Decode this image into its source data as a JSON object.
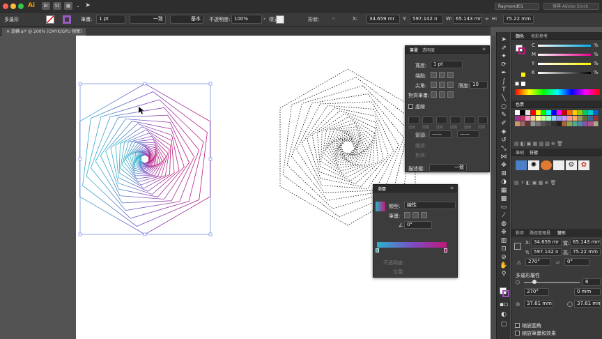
{
  "app": {
    "logo": "Ai",
    "workspace": "Raymond01",
    "stock_placeholder": "搜尋 Adobe Stock"
  },
  "menu": {
    "buttons": [
      "Br",
      "St"
    ]
  },
  "control": {
    "selection": "多邊形",
    "stroke_label": "筆畫:",
    "stroke_weight": "1 pt",
    "profile": "一致",
    "brush": "基本",
    "opacity_label": "不透明度:",
    "opacity": "100%",
    "style_label": "樣式:",
    "shape_label": "形狀:",
    "x_label": "X:",
    "x": "34.659 mr",
    "y_label": "Y:",
    "y": "597.142 n",
    "w_label": "W:",
    "w": "65.143 mr",
    "h_label": "H:",
    "h": "75.22 mm"
  },
  "document": {
    "tab": "旋轉.ai* @ 200% (CMYK/GPU 預覽)"
  },
  "stroke_panel": {
    "tabs": [
      "筆畫",
      "透明度"
    ],
    "weight_label": "寬度:",
    "weight": "1 pt",
    "cap_label": "端點:",
    "corner_label": "尖角:",
    "limit_label": "限度:",
    "limit": "10",
    "align_label": "對齊筆畫:",
    "dashed_label": "虛線",
    "dash_cells": [
      "虛線",
      "間隔",
      "虛線",
      "間隔",
      "虛線",
      "間隔"
    ],
    "arrow_label": "箭頭:",
    "scale_label": "縮放:",
    "align2_label": "對齊:",
    "profile_label": "描述檔:",
    "profile": "一致"
  },
  "gradient_panel": {
    "title": "漸層",
    "type_label": "類型:",
    "type": "線性",
    "stroke_label": "筆畫:",
    "angle": "0°",
    "opacity_label": "不透明度:",
    "location_label": "位置:"
  },
  "color_panel": {
    "tabs": [
      "顏色",
      "色彩參考"
    ],
    "channels": [
      {
        "name": "C",
        "unit": "%"
      },
      {
        "name": "M",
        "unit": "%"
      },
      {
        "name": "Y",
        "unit": "%"
      },
      {
        "name": "K",
        "unit": "%"
      }
    ]
  },
  "swatches_panel": {
    "title": "色票"
  },
  "brushes_panel": {
    "tabs": [
      "筆刷",
      "符號"
    ]
  },
  "transform_panel": {
    "tabs": [
      "對齊",
      "路徑管理員",
      "變形"
    ],
    "x_label": "X:",
    "x": "34.659 mr",
    "y_label": "Y:",
    "y": "597.142 n",
    "w_label": "寬:",
    "w": "65.143 mm",
    "h_label": "高:",
    "h": "75.22 mm",
    "angle": "270°",
    "shear": "0°",
    "polygon_title": "多邊形屬性",
    "sides": "6",
    "poly_angle": "270°",
    "corner": "0 mm",
    "radius": "37.61 mm",
    "side_len": "37.61 mm",
    "scale_corners": "縮放圓角",
    "scale_strokes": "縮放筆畫和效果"
  },
  "colors": {
    "grad_start": "#2bb3c9",
    "grad_end": "#c0187a",
    "grad_mid": "#7a4fc6"
  }
}
